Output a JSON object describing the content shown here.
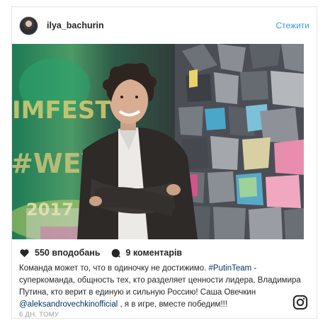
{
  "post": {
    "username": "ilya_bachurin",
    "follow_label": "Стежити",
    "likes": "550 вподобань",
    "comments": "9 коментарів",
    "caption_part1": "Команда может то, что в одиночку не достижимо. ",
    "hashtag": "#PutinTeam",
    "caption_part2": " - суперкоманда, общность тех, кто разделяет ценности лидера, Владимира Путина, кто верит в единую и сильную Россию! Саша Овечкин ",
    "mention": "@aleksandrovechkinofficial",
    "caption_part3": " , я в игре, вместе победим!!!",
    "time_ago": "6 ДН. ТОМУ"
  },
  "photo": {
    "graffiti_lines": [
      "IMFEST",
      "#WEYS",
      "2017"
    ]
  },
  "icons": {
    "heart": "heart-icon",
    "comment": "comment-bubble-icon",
    "instagram": "instagram-logo-icon",
    "avatar": "avatar"
  },
  "colors": {
    "link": "#3897f0",
    "tag": "#003569",
    "text": "#262626",
    "muted": "#999999"
  }
}
